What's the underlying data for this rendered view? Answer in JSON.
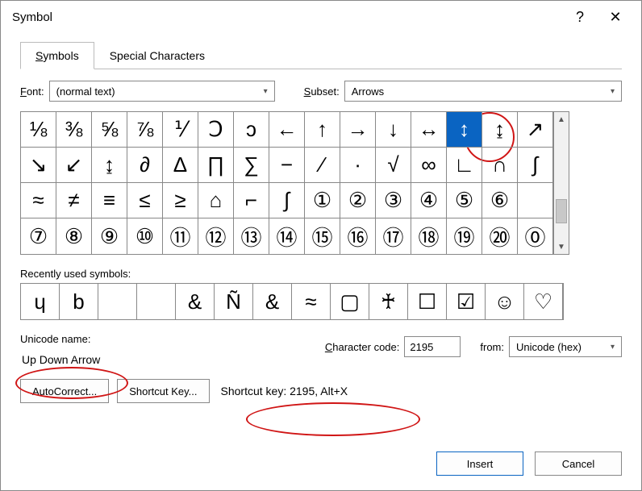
{
  "window": {
    "title": "Symbol",
    "help": "?",
    "close": "✕"
  },
  "tabs": {
    "symbols_prefix": "S",
    "symbols_rest": "ymbols",
    "special": "Special Characters"
  },
  "font": {
    "label_prefix": "F",
    "label_rest": "ont:",
    "value": "(normal text)"
  },
  "subset": {
    "label_prefix": "S",
    "label_rest": "ubset:",
    "value": "Arrows"
  },
  "grid": {
    "rows": [
      [
        "⅛",
        "⅜",
        "⅝",
        "⅞",
        "⅟",
        "Ↄ",
        "ↄ",
        "←",
        "↑",
        "→",
        "↓",
        "↔",
        "↕",
        "↨",
        "↗"
      ],
      [
        "↘",
        "↙",
        "↨",
        "∂",
        "∆",
        "∏",
        "∑",
        "−",
        "∕",
        "∙",
        "√",
        "∞",
        "∟",
        "∩",
        "∫"
      ],
      [
        "≈",
        "≠",
        "≡",
        "≤",
        "≥",
        "⌂",
        "⌐",
        "∫",
        "①",
        "②",
        "③",
        "④",
        "⑤",
        "⑥",
        ""
      ],
      [
        "⑦",
        "⑧",
        "⑨",
        "⑩",
        "⑪",
        "⑫",
        "⑬",
        "⑭",
        "⑮",
        "⑯",
        "⑰",
        "⑱",
        "⑲",
        "⑳",
        "⓪"
      ]
    ],
    "selected_index": 12
  },
  "recent": {
    "label_prefix": "R",
    "label_rest": "ecently used symbols:",
    "items": [
      "ɥ",
      "b",
      "",
      "",
      "&",
      "Ñ",
      "&",
      "≈",
      "▢",
      "♰",
      "☐",
      "☑",
      "☺",
      "♡"
    ]
  },
  "unicode": {
    "label": "Unicode name:",
    "value": "Up Down Arrow"
  },
  "charcode": {
    "label_prefix": "C",
    "label_rest": "haracter code:",
    "value": "2195"
  },
  "from": {
    "label_prefix": "",
    "label_rest": "from:",
    "value": "Unicode (hex)"
  },
  "buttons": {
    "autocorrect_prefix": "A",
    "autocorrect_rest": "utoCorrect...",
    "shortcut_key_prefix": "",
    "shortcut_key_rest": "Shortcut Key...",
    "shortcut_text": "Shortcut key: 2195, Alt+X"
  },
  "footer": {
    "insert_prefix": "I",
    "insert_rest": "nsert",
    "cancel": "Cancel"
  }
}
